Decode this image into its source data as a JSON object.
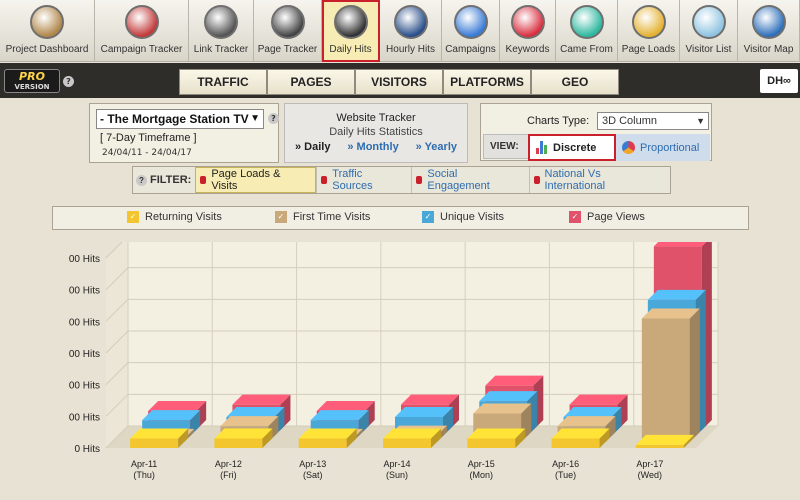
{
  "nav": [
    {
      "label": "Project Dashboard",
      "icon": "dashboard-icon",
      "color": "#b0874a",
      "w": 95
    },
    {
      "label": "Campaign Tracker",
      "icon": "campaign-icon",
      "color": "#c23a3a",
      "w": 94
    },
    {
      "label": "Link Tracker",
      "icon": "link-icon",
      "color": "#555555",
      "w": 65
    },
    {
      "label": "Page Tracker",
      "icon": "page-icon",
      "color": "#444444",
      "w": 68
    },
    {
      "label": "Daily Hits",
      "icon": "daily-hits-icon",
      "color": "#333333",
      "w": 58,
      "active": true
    },
    {
      "label": "Hourly Hits",
      "icon": "clock-icon",
      "color": "#2a4f8a",
      "w": 62
    },
    {
      "label": "Campaigns",
      "icon": "campaigns-icon",
      "color": "#3a7bd5",
      "w": 58
    },
    {
      "label": "Keywords",
      "icon": "keywords-icon",
      "color": "#d83040",
      "w": 56
    },
    {
      "label": "Came From",
      "icon": "came-from-icon",
      "color": "#2fb89f",
      "w": 62
    },
    {
      "label": "Page Loads",
      "icon": "page-loads-icon",
      "color": "#e4b233",
      "w": 62
    },
    {
      "label": "Visitor List",
      "icon": "visitor-icon",
      "color": "#8fc4e0",
      "w": 58
    },
    {
      "label": "Visitor Map",
      "icon": "globe-icon",
      "color": "#2f6fba",
      "w": 62
    }
  ],
  "badge": {
    "pro": "PRO",
    "version": "VERSION"
  },
  "tabs": [
    "TRAFFIC",
    "PAGES",
    "VISITORS",
    "PLATFORMS",
    "GEO"
  ],
  "dh_logo": "DH∞",
  "site": {
    "name": "- The Mortgage Station TV",
    "timeframe": "[ 7-Day Timeframe ]",
    "date_range": "24/04/11 - 24/04/17"
  },
  "tracker": {
    "title": "Website Tracker",
    "subtitle": "Daily Hits Statistics",
    "daily": "» Daily",
    "monthly": "» Monthly",
    "yearly": "» Yearly"
  },
  "chart_type": {
    "label": "Charts Type:",
    "selected": "3D Column",
    "view_label": "VIEW:",
    "discrete": "Discrete",
    "proportional": "Proportional"
  },
  "filter": {
    "label": "FILTER:",
    "items": [
      {
        "label": "Page Loads & Visits",
        "active": true
      },
      {
        "label": "Traffic Sources",
        "active": false
      },
      {
        "label": "Social Engagement",
        "active": false
      },
      {
        "label": "National Vs International",
        "active": false
      }
    ]
  },
  "chart_data": {
    "type": "bar",
    "style": "3d-column",
    "categories": [
      "Apr-11\n(Thu)",
      "Apr-12\n(Fri)",
      "Apr-13\n(Sat)",
      "Apr-14\n(Sun)",
      "Apr-15\n(Mon)",
      "Apr-16\n(Tue)",
      "Apr-17\n(Wed)"
    ],
    "ytick_labels": [
      "0 Hits",
      "00 Hits",
      "00 Hits",
      "00 Hits",
      "00 Hits",
      "00 Hits",
      "00 Hits"
    ],
    "ylim": [
      0,
      6
    ],
    "grid": true,
    "legend": "top",
    "series": [
      {
        "name": "Returning Visits",
        "color": "#f3c630",
        "values": [
          0.3,
          0.3,
          0.3,
          0.3,
          0.3,
          0.3,
          0.1
        ]
      },
      {
        "name": "First Time Visits",
        "color": "#c9a97a",
        "values": [
          0.1,
          0.5,
          0.1,
          0.2,
          0.9,
          0.5,
          3.9
        ]
      },
      {
        "name": "Unique Visits",
        "color": "#4aa8d9",
        "values": [
          0.5,
          0.6,
          0.5,
          0.6,
          1.1,
          0.6,
          4.3
        ]
      },
      {
        "name": "Page Views",
        "color": "#e0516a",
        "values": [
          0.6,
          0.8,
          0.6,
          0.8,
          1.4,
          0.8,
          5.8
        ]
      }
    ]
  }
}
